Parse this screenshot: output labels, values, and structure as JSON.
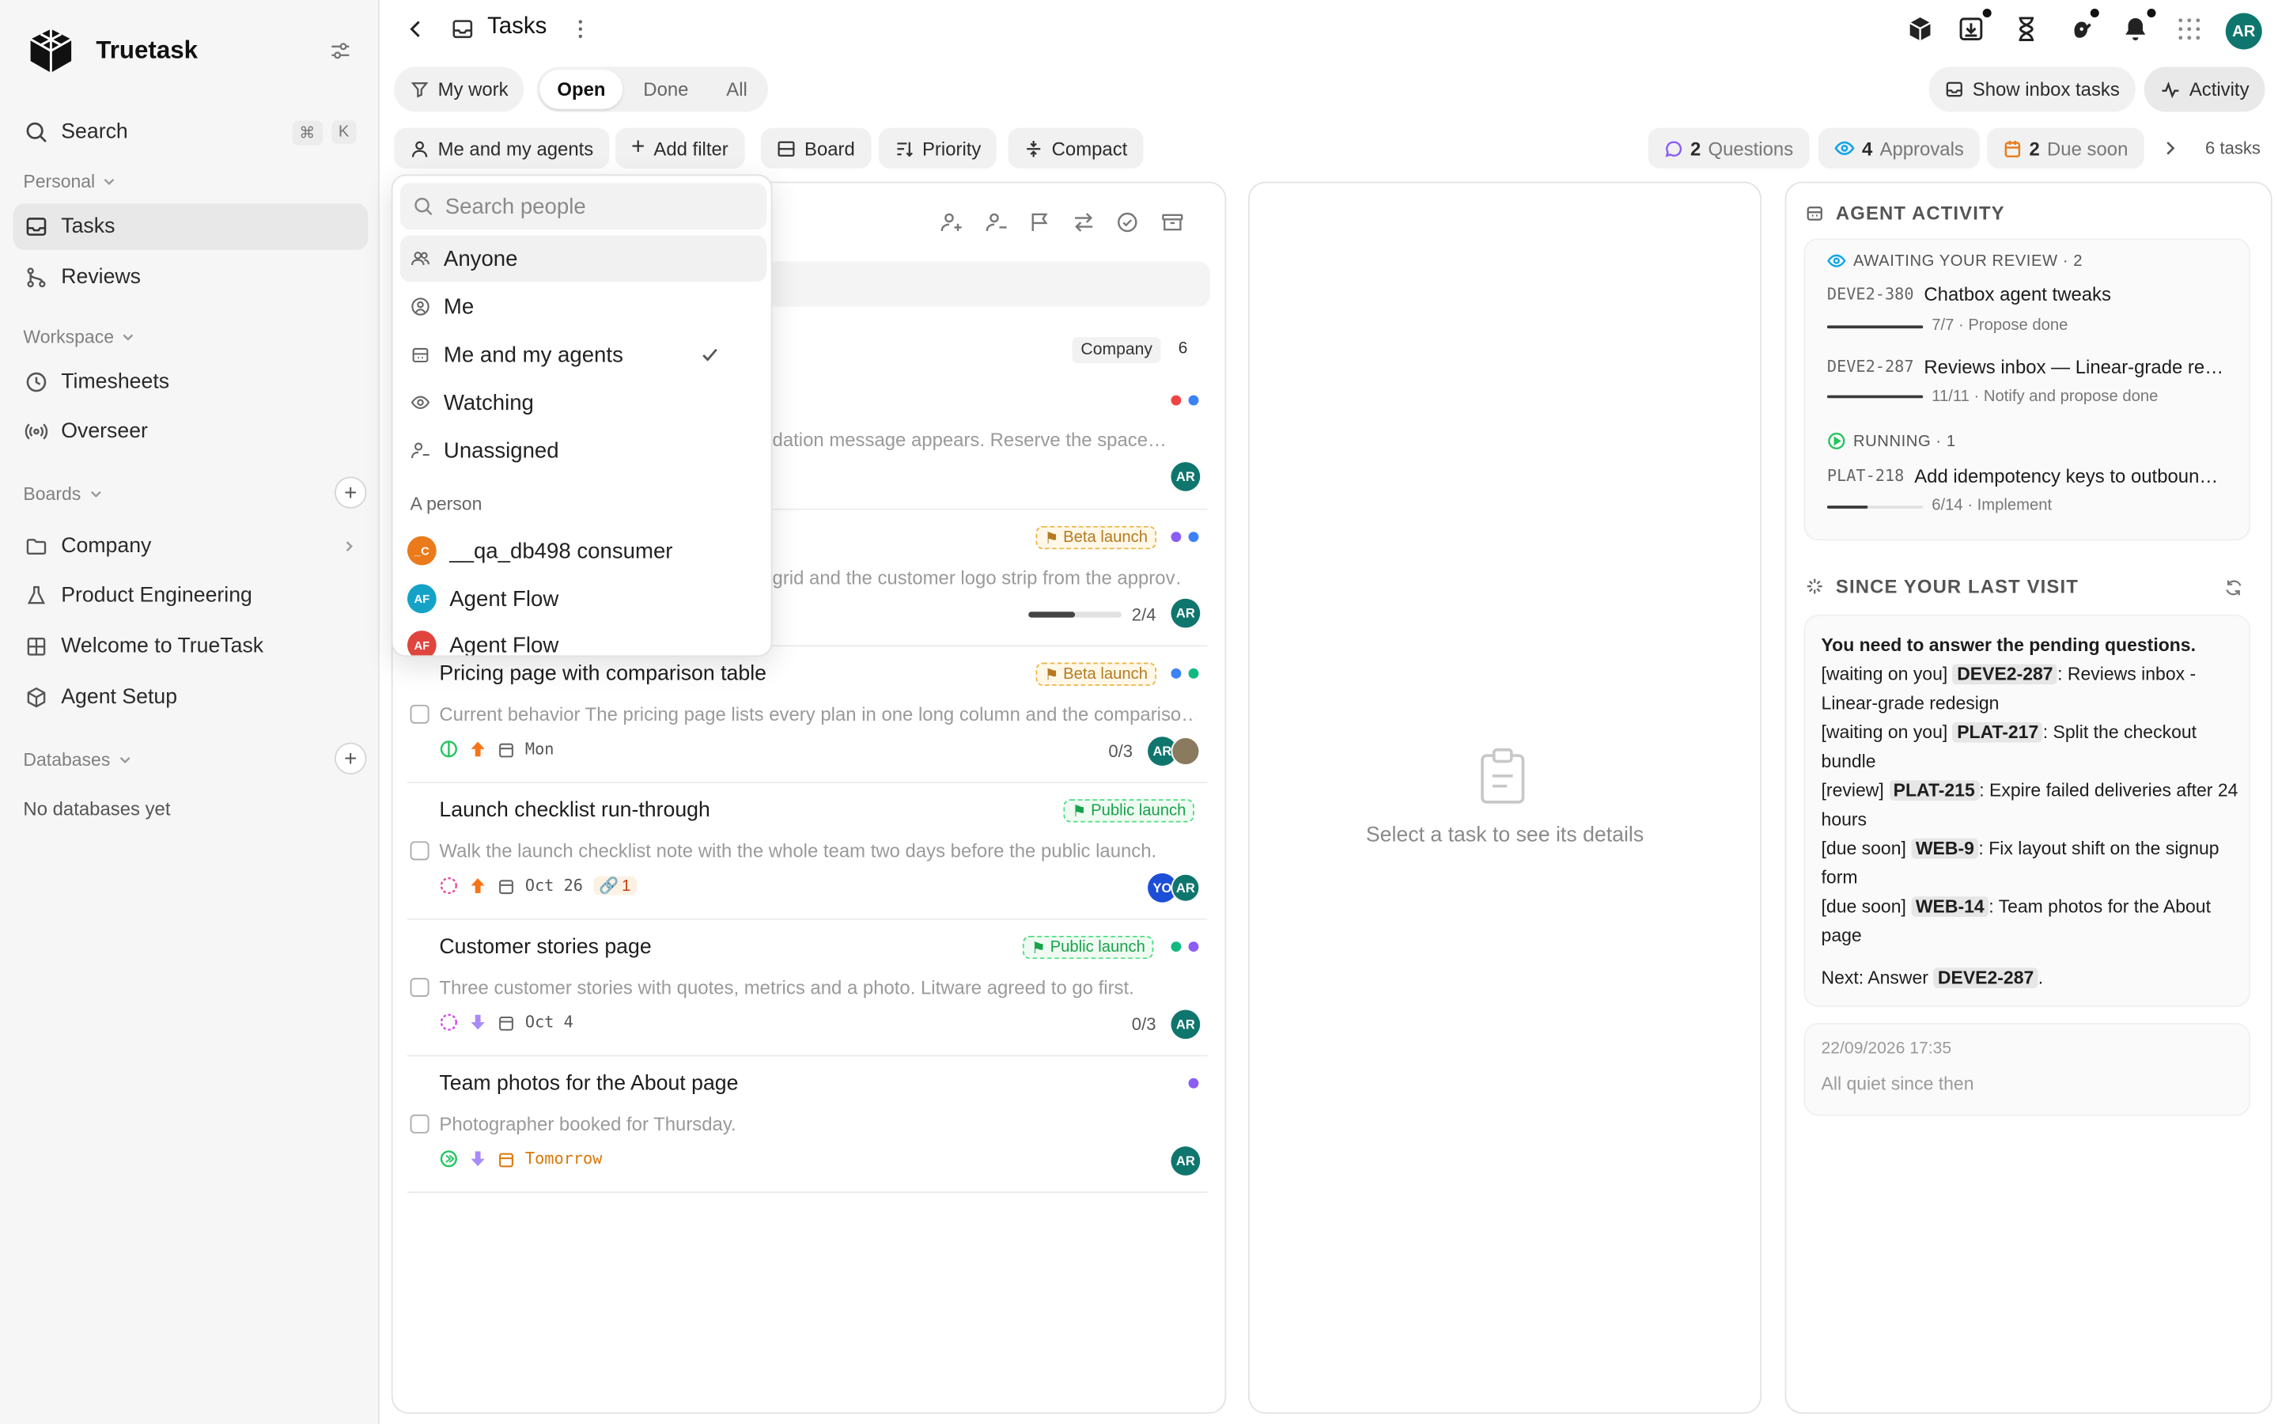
{
  "brand": {
    "name": "Truetask"
  },
  "sidebar": {
    "search_label": "Search",
    "search_kbd": [
      "⌘",
      "K"
    ],
    "personal_label": "Personal",
    "personal_items": [
      {
        "label": "Tasks"
      },
      {
        "label": "Reviews"
      }
    ],
    "workspace_label": "Workspace",
    "workspace_items": [
      {
        "label": "Timesheets"
      },
      {
        "label": "Overseer"
      }
    ],
    "boards_label": "Boards",
    "boards": [
      {
        "label": "Company"
      },
      {
        "label": "Product Engineering"
      },
      {
        "label": "Welcome to TrueTask"
      },
      {
        "label": "Agent Setup"
      }
    ],
    "databases_label": "Databases",
    "databases_empty": "No databases yet"
  },
  "header": {
    "title": "Tasks"
  },
  "toolbar": {
    "my_work": "My work",
    "tabs": [
      "Open",
      "Done",
      "All"
    ],
    "show_inbox": "Show inbox tasks",
    "activity": "Activity",
    "people_filter": "Me and my agents",
    "add_filter": "Add filter",
    "board": "Board",
    "priority": "Priority",
    "compact": "Compact",
    "questions_count": "2",
    "questions_label": "Questions",
    "approvals_count": "4",
    "approvals_label": "Approvals",
    "due_count": "2",
    "due_label": "Due soon",
    "tasks_count": "6 tasks"
  },
  "dropdown": {
    "search_placeholder": "Search people",
    "options": [
      "Anyone",
      "Me",
      "Me and my agents",
      "Watching",
      "Unassigned"
    ],
    "person_header": "A person",
    "people": [
      {
        "initials": "_C",
        "name": "__qa_db498 consumer",
        "color": "#ea7a1a"
      },
      {
        "initials": "AF",
        "name": "Agent Flow",
        "color": "#14a3c7"
      },
      {
        "initials": "AF",
        "name": "Agent Flow",
        "color": "#e0453d"
      }
    ]
  },
  "list": {
    "group_label": "Company",
    "group_count": "6",
    "task1": {
      "desc": "dation message appears. Reserve the space…",
      "avatar": "AR"
    },
    "task2": {
      "tag": "Beta launch",
      "desc": "grid and the customer logo strip from the approv…",
      "progress": 0.5,
      "progress_label": "2/4",
      "avatar": "AR"
    },
    "task3": {
      "title": "Pricing page with comparison table",
      "tag": "Beta launch",
      "desc": "Current behavior The pricing page lists every plan in one long column and the compariso…",
      "date": "Mon",
      "count": "0/3",
      "avatar": "AR"
    },
    "task4": {
      "title": "Launch checklist run-through",
      "tag": "Public launch",
      "desc": "Walk the launch checklist note with the whole team two days before the public launch.",
      "date": "Oct 26",
      "links": "1",
      "avatars": [
        "YO",
        "AR"
      ]
    },
    "task5": {
      "title": "Customer stories page",
      "tag": "Public launch",
      "desc": "Three customer stories with quotes, metrics and a photo. Litware agreed to go first.",
      "date": "Oct 4",
      "count": "0/3",
      "avatar": "AR"
    },
    "task6": {
      "title": "Team photos for the About page",
      "desc": "Photographer booked for Thursday.",
      "date": "Tomorrow",
      "avatar": "AR"
    }
  },
  "details": {
    "empty": "Select a task to see its details"
  },
  "activity": {
    "title": "AGENT ACTIVITY",
    "awaiting_label": "AWAITING YOUR REVIEW · 2",
    "awaiting": [
      {
        "id": "DEVE2-380",
        "title": "Chatbox agent tweaks",
        "progress": "7/7",
        "step": "Propose done",
        "fraction": 1.0
      },
      {
        "id": "DEVE2-287",
        "title": "Reviews inbox — Linear-grade re…",
        "progress": "11/11",
        "step": "Notify and propose done",
        "fraction": 1.0
      }
    ],
    "running_label": "RUNNING · 1",
    "running": [
      {
        "id": "PLAT-218",
        "title": "Add idempotency keys to outboun…",
        "progress": "6/14",
        "step": "Implement",
        "fraction": 0.43
      }
    ],
    "sep": " · "
  },
  "since": {
    "title": "SINCE YOUR LAST VISIT",
    "headline": "You need to answer the pending questions.",
    "lines": [
      {
        "prefix": "[waiting on you]",
        "code": "DEVE2-287",
        "text": ": Reviews inbox - Linear-grade redesign"
      },
      {
        "prefix": "[waiting on you]",
        "code": "PLAT-217",
        "text": ": Split the checkout bundle"
      },
      {
        "prefix": "[review]",
        "code": "PLAT-215",
        "text": ": Expire failed deliveries after 24 hours"
      },
      {
        "prefix": "[due soon]",
        "code": "WEB-9",
        "text": ": Fix layout shift on the signup form"
      },
      {
        "prefix": "[due soon]",
        "code": "WEB-14",
        "text": ": Team photos for the About page"
      }
    ],
    "next_prefix": "Next: Answer",
    "next_code": "DEVE2-287",
    "next_suffix": ".",
    "timestamp": "22/09/2026 17:35",
    "quiet": "All quiet since then"
  },
  "user": {
    "initials": "AR"
  },
  "colors": {
    "teal": "#0f766e",
    "beta": "#f0b445",
    "public": "#4ade80"
  }
}
